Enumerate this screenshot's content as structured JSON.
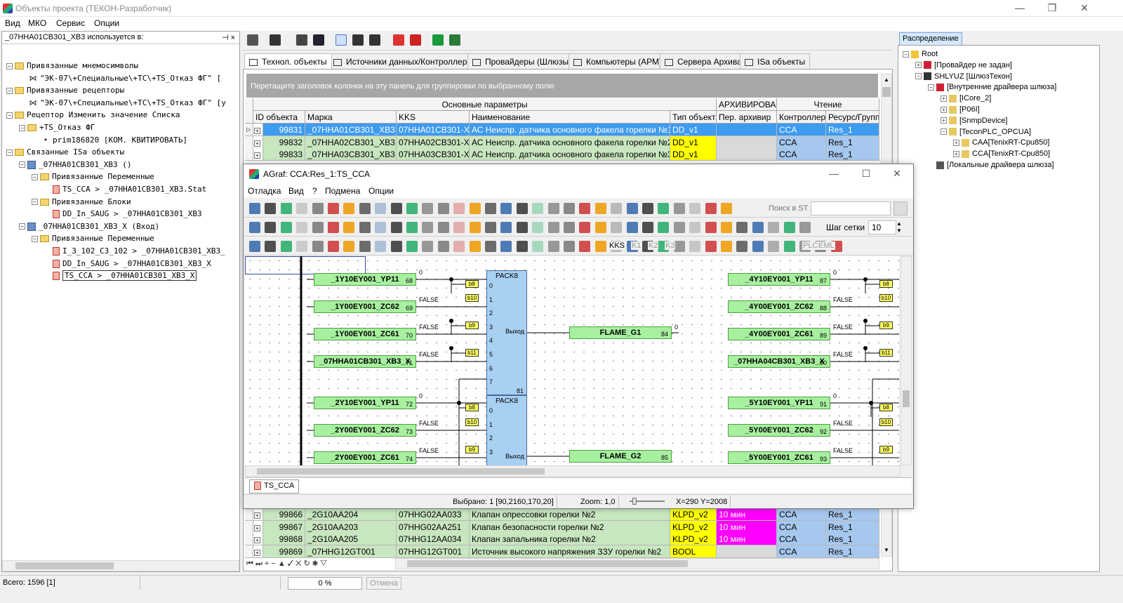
{
  "window": {
    "title": "Объекты проекта (ТЕКОН-Разработчик)",
    "min": "—",
    "max": "❐",
    "close": "✕"
  },
  "menu": [
    "Вид",
    "МКО",
    "Сервис",
    "Опции"
  ],
  "left_panel": {
    "header": "_07HHA01CB301_XB3 используется в:",
    "pin": "⊣ ×",
    "rows": [
      "Привязанные мнемосимволы",
      "\"ЭК-07\\+Специальные\\+ТС\\+TS_Отказ ФГ\"  [",
      "Привязанные рецепторы",
      "\"ЭК-07\\+Специальные\\+ТС\\+TS_Отказ ФГ\" [у",
      "Рецептор Изменить значение Списка",
      "+TS_Отказ ФГ",
      "prim186820   [КОМ. КВИТИРОВАТЬ]",
      "Связанные ISa объекты",
      "_07HHA01CB301_XB3  ()",
      "Привязанные Переменные",
      "TS_CCA > _07HHA01CB301_XB3.Stat",
      "Привязанные Блоки",
      "DD_In_SAUG > _07HHA01CB301_XB3",
      "_07HHA01CB301_XB3_X  (Вход)",
      "Привязанные Переменные",
      "I_3_102_C3_102 > _07HHA01CB301_XB3_",
      "DD_In_SAUG > _07HHA01CB301_XB3_X",
      "TS_CCA > _07HHA01CB301_XB3_X"
    ]
  },
  "tabs": [
    "Технол. объекты",
    "Источники данных/Контроллеры",
    "Провайдеры (Шлюзы)",
    "Компьютеры (АРМ)",
    "Сервера Архива",
    "ISa объекты"
  ],
  "group_panel_hint": "Перетащите заголовок колонки на эту панель для группировки по выбранному полю",
  "grid": {
    "group_headers": [
      "Основные параметры",
      "АРХИВИРОВАНИ",
      "Чтение"
    ],
    "columns": [
      "ID объекта",
      "Марка",
      "KKS",
      "Наименование",
      "Тип объекта",
      "Пер. архивир",
      "Контроллер",
      "Ресурс/Группа"
    ],
    "top_rows": [
      [
        "99831",
        "_07HHA01CB301_XB3",
        "07HHA01CB301-XB3",
        "АС Неиспр. датчика основного факела горелки №1",
        "DD_v1",
        "",
        "CCA",
        "Res_1"
      ],
      [
        "99832",
        "_07HHA02CB301_XB3",
        "07HHA02CB301-XB3",
        "АС Неиспр. датчика основного факела горелки №2",
        "DD_v1",
        "",
        "CCA",
        "Res_1"
      ],
      [
        "99833",
        "_07HHA03CB301_XB3",
        "07HHA03CB301-XB3",
        "АС Неиспр. датчика основного факела горелки №3",
        "DD_v1",
        "",
        "CCA",
        "Res_1"
      ]
    ],
    "bottom_rows": [
      [
        "99866",
        "_2G10AA204",
        "07HHG02AA033",
        "Клапан опрессовки горелки №2",
        "KLPD_v2",
        "10 мин",
        "CCA",
        "Res_1"
      ],
      [
        "99867",
        "_2G10AA203",
        "07HHG02AA251",
        "Клапан безопасности горелки №2",
        "KLPD_v2",
        "10 мин",
        "CCA",
        "Res_1"
      ],
      [
        "99868",
        "_2G10AA205",
        "07HHG12AA034",
        "Клапан запальника горелки №2",
        "KLPD_v2",
        "10 мин",
        "CCA",
        "Res_1"
      ],
      [
        "99869",
        "_07HHG12GT001",
        "07HHG12GT001",
        "Источник высокого напряжения ЗЗУ горелки №2",
        "BOOL",
        "",
        "CCA",
        "Res_1"
      ]
    ],
    "nav": "⏮ ⏭ + − ▲ ✓ ✕ ↻ ✱ ▽"
  },
  "right_panel": {
    "header": "Распределение",
    "rows": [
      "Root",
      "[Провайдер не задан]",
      "SHLYUZ [ШлюзТекон]",
      "[Внутренние драйвера шлюза]",
      "[ICore_2]",
      "[P06I]",
      "[SnmpDevice]",
      "[TeconPLC_OPCUA]",
      "CAA[TenixRT-Cpu850]",
      "CCA[TenixRT-Cpu850]",
      "[Локальные драйвера шлюза]"
    ]
  },
  "agraf": {
    "title": "AGraf: CCA:Res_1:TS_CCA",
    "menu": [
      "Отладка",
      "Вид",
      "?",
      "Подмена",
      "Опции"
    ],
    "search_label": "Поиск в ST",
    "grid_step_label": "Шаг сетки",
    "grid_step_value": "10",
    "kks_labels": [
      "KKS",
      "K1",
      "K2",
      "K3",
      "PLC",
      "EML"
    ],
    "tab": "TS_CCA",
    "status": [
      "Выбрано: 1  [90,2160,170,20]",
      "Zoom: 1,0",
      "X=290 Y=2008"
    ],
    "left_blocks": [
      {
        "name": "_1Y10EY001_YP11",
        "n": "68",
        "out": "0"
      },
      {
        "name": "_1Y00EY001_ZC62",
        "n": "69",
        "out": "FALSE"
      },
      {
        "name": "_1Y00EY001_ZC61",
        "n": "70",
        "out": "FALSE"
      },
      {
        "name": "_07HHA01CB301_XB3_X",
        "n": "71",
        "out": "FALSE"
      },
      {
        "name": "_2Y10EY001_YP11",
        "n": "72",
        "out": "0"
      },
      {
        "name": "_2Y00EY001_ZC62",
        "n": "73",
        "out": "FALSE"
      },
      {
        "name": "_2Y00EY001_ZC61",
        "n": "74",
        "out": "FALSE"
      }
    ],
    "right_blocks": [
      {
        "name": "_4Y10EY001_YP11",
        "n": "87",
        "out": "0"
      },
      {
        "name": "_4Y00EY001_ZC62",
        "n": "88",
        "out": "FALSE"
      },
      {
        "name": "_4Y00EY001_ZC61",
        "n": "89",
        "out": "FALSE"
      },
      {
        "name": "_07HHA04CB301_XB3_X",
        "n": "90",
        "out": "FALSE"
      },
      {
        "name": "_5Y10EY001_YP11",
        "n": "91",
        "out": "0"
      },
      {
        "name": "_5Y00EY001_ZC62",
        "n": "92",
        "out": "FALSE"
      },
      {
        "name": "_5Y00EY001_ZC61",
        "n": "93",
        "out": "FALSE"
      }
    ],
    "tags": [
      "b8",
      "b10",
      "b9",
      "b11"
    ],
    "pack1": {
      "title": "PACK8",
      "out": "Выход",
      "n": "81",
      "ports": [
        "0",
        "1",
        "2",
        "3",
        "4",
        "5",
        "6",
        "7"
      ]
    },
    "pack2": {
      "title": "PACK8",
      "out": "Выход",
      "ports": [
        "0",
        "1",
        "2",
        "3"
      ]
    },
    "flame1": {
      "name": "FLAME_G1",
      "n": "84",
      "out": "0"
    },
    "flame2": {
      "name": "FLAME_G2",
      "n": "85"
    }
  },
  "statusbar": {
    "total": "Всего: 1596 [1]",
    "progress": "0 %",
    "cancel": "Отмена"
  }
}
